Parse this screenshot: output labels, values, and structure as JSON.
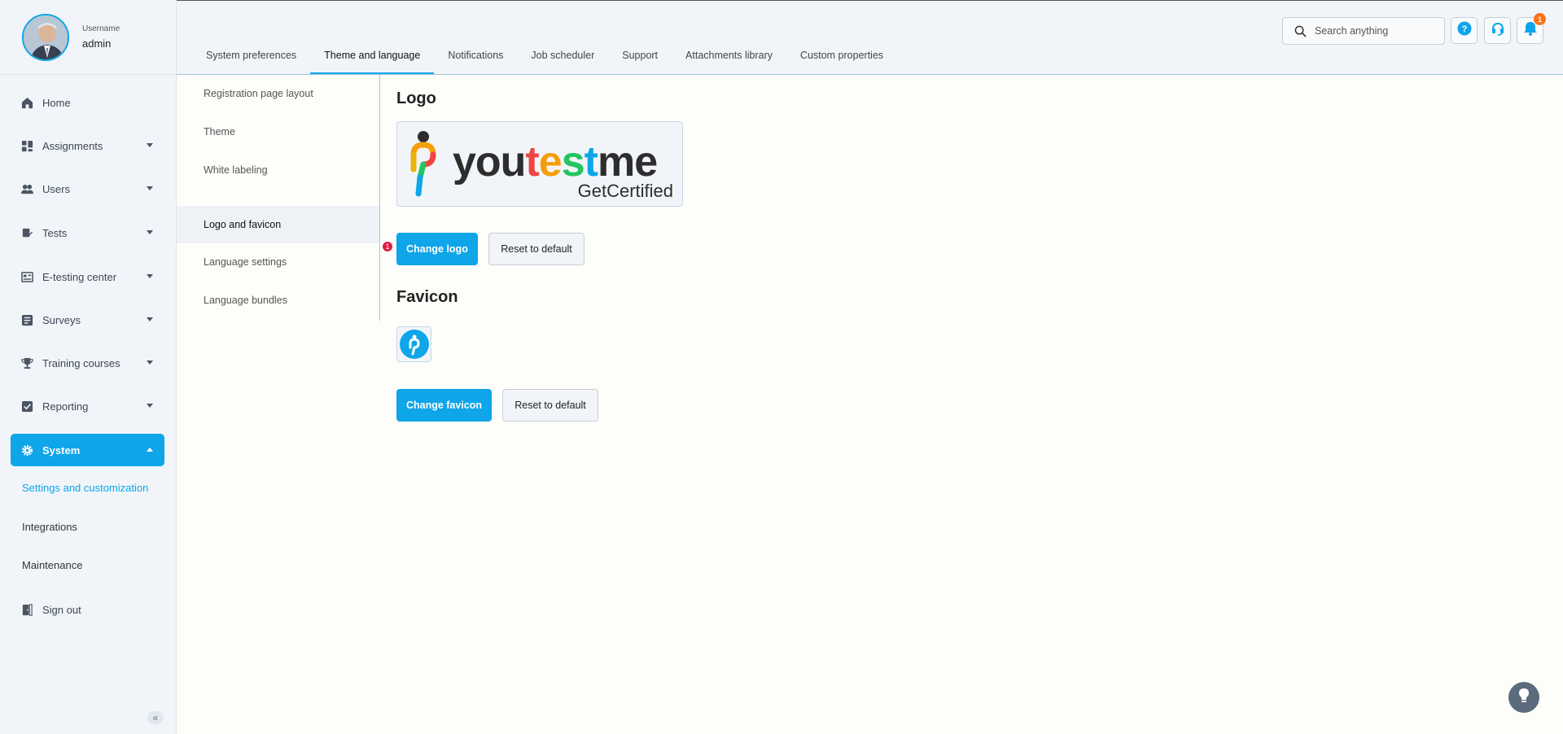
{
  "profile": {
    "label": "Username",
    "name": "admin"
  },
  "sidebar": {
    "items": [
      {
        "label": "Home",
        "icon": "home-icon"
      },
      {
        "label": "Assignments",
        "icon": "assignments-icon"
      },
      {
        "label": "Users",
        "icon": "users-icon"
      },
      {
        "label": "Tests",
        "icon": "tests-icon"
      },
      {
        "label": "E-testing center",
        "icon": "e-testing-center-icon"
      },
      {
        "label": "Surveys",
        "icon": "surveys-icon"
      },
      {
        "label": "Training courses",
        "icon": "trophy-icon"
      },
      {
        "label": "Reporting",
        "icon": "reporting-icon"
      },
      {
        "label": "System",
        "icon": "gear-icon"
      }
    ],
    "system_sub": [
      "Settings and customization",
      "Integrations",
      "Maintenance"
    ],
    "signout": "Sign out"
  },
  "tabs": [
    "System preferences",
    "Theme and language",
    "Notifications",
    "Job scheduler",
    "Support",
    "Attachments library",
    "Custom properties"
  ],
  "search": {
    "placeholder": "Search anything"
  },
  "notifications": {
    "count": "1"
  },
  "subnav": [
    "Registration page layout",
    "Theme",
    "White labeling",
    "Logo and favicon",
    "Language settings",
    "Language bundles"
  ],
  "content": {
    "logo_title": "Logo",
    "logo_brand": {
      "you": "you",
      "t1": "t",
      "e": "e",
      "s": "s",
      "t2": "t",
      "me": "me",
      "tagline": "GetCertified"
    },
    "change_logo": "Change logo",
    "reset_logo": "Reset to default",
    "step_marker": "1",
    "favicon_title": "Favicon",
    "change_favicon": "Change favicon",
    "reset_favicon": "Reset to default"
  },
  "colors": {
    "accent": "#0ea5e9",
    "badge": "#f97316",
    "marker": "#e11d48"
  }
}
